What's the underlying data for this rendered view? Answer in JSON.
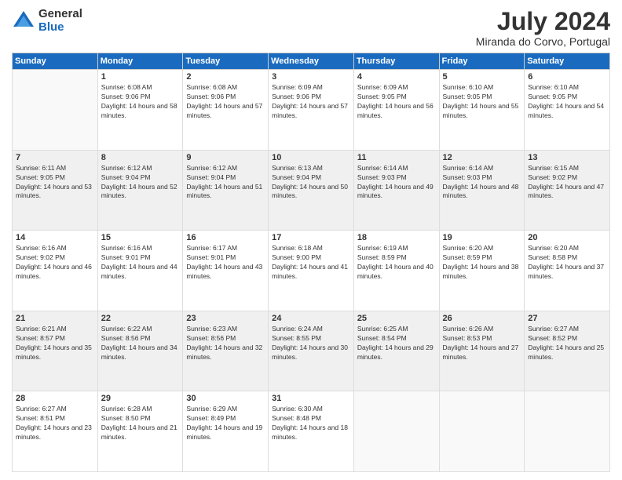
{
  "logo": {
    "general": "General",
    "blue": "Blue"
  },
  "title": "July 2024",
  "location": "Miranda do Corvo, Portugal",
  "weekdays": [
    "Sunday",
    "Monday",
    "Tuesday",
    "Wednesday",
    "Thursday",
    "Friday",
    "Saturday"
  ],
  "weeks": [
    [
      {
        "day": "",
        "sunrise": "",
        "sunset": "",
        "daylight": ""
      },
      {
        "day": "1",
        "sunrise": "Sunrise: 6:08 AM",
        "sunset": "Sunset: 9:06 PM",
        "daylight": "Daylight: 14 hours and 58 minutes."
      },
      {
        "day": "2",
        "sunrise": "Sunrise: 6:08 AM",
        "sunset": "Sunset: 9:06 PM",
        "daylight": "Daylight: 14 hours and 57 minutes."
      },
      {
        "day": "3",
        "sunrise": "Sunrise: 6:09 AM",
        "sunset": "Sunset: 9:06 PM",
        "daylight": "Daylight: 14 hours and 57 minutes."
      },
      {
        "day": "4",
        "sunrise": "Sunrise: 6:09 AM",
        "sunset": "Sunset: 9:05 PM",
        "daylight": "Daylight: 14 hours and 56 minutes."
      },
      {
        "day": "5",
        "sunrise": "Sunrise: 6:10 AM",
        "sunset": "Sunset: 9:05 PM",
        "daylight": "Daylight: 14 hours and 55 minutes."
      },
      {
        "day": "6",
        "sunrise": "Sunrise: 6:10 AM",
        "sunset": "Sunset: 9:05 PM",
        "daylight": "Daylight: 14 hours and 54 minutes."
      }
    ],
    [
      {
        "day": "7",
        "sunrise": "Sunrise: 6:11 AM",
        "sunset": "Sunset: 9:05 PM",
        "daylight": "Daylight: 14 hours and 53 minutes."
      },
      {
        "day": "8",
        "sunrise": "Sunrise: 6:12 AM",
        "sunset": "Sunset: 9:04 PM",
        "daylight": "Daylight: 14 hours and 52 minutes."
      },
      {
        "day": "9",
        "sunrise": "Sunrise: 6:12 AM",
        "sunset": "Sunset: 9:04 PM",
        "daylight": "Daylight: 14 hours and 51 minutes."
      },
      {
        "day": "10",
        "sunrise": "Sunrise: 6:13 AM",
        "sunset": "Sunset: 9:04 PM",
        "daylight": "Daylight: 14 hours and 50 minutes."
      },
      {
        "day": "11",
        "sunrise": "Sunrise: 6:14 AM",
        "sunset": "Sunset: 9:03 PM",
        "daylight": "Daylight: 14 hours and 49 minutes."
      },
      {
        "day": "12",
        "sunrise": "Sunrise: 6:14 AM",
        "sunset": "Sunset: 9:03 PM",
        "daylight": "Daylight: 14 hours and 48 minutes."
      },
      {
        "day": "13",
        "sunrise": "Sunrise: 6:15 AM",
        "sunset": "Sunset: 9:02 PM",
        "daylight": "Daylight: 14 hours and 47 minutes."
      }
    ],
    [
      {
        "day": "14",
        "sunrise": "Sunrise: 6:16 AM",
        "sunset": "Sunset: 9:02 PM",
        "daylight": "Daylight: 14 hours and 46 minutes."
      },
      {
        "day": "15",
        "sunrise": "Sunrise: 6:16 AM",
        "sunset": "Sunset: 9:01 PM",
        "daylight": "Daylight: 14 hours and 44 minutes."
      },
      {
        "day": "16",
        "sunrise": "Sunrise: 6:17 AM",
        "sunset": "Sunset: 9:01 PM",
        "daylight": "Daylight: 14 hours and 43 minutes."
      },
      {
        "day": "17",
        "sunrise": "Sunrise: 6:18 AM",
        "sunset": "Sunset: 9:00 PM",
        "daylight": "Daylight: 14 hours and 41 minutes."
      },
      {
        "day": "18",
        "sunrise": "Sunrise: 6:19 AM",
        "sunset": "Sunset: 8:59 PM",
        "daylight": "Daylight: 14 hours and 40 minutes."
      },
      {
        "day": "19",
        "sunrise": "Sunrise: 6:20 AM",
        "sunset": "Sunset: 8:59 PM",
        "daylight": "Daylight: 14 hours and 38 minutes."
      },
      {
        "day": "20",
        "sunrise": "Sunrise: 6:20 AM",
        "sunset": "Sunset: 8:58 PM",
        "daylight": "Daylight: 14 hours and 37 minutes."
      }
    ],
    [
      {
        "day": "21",
        "sunrise": "Sunrise: 6:21 AM",
        "sunset": "Sunset: 8:57 PM",
        "daylight": "Daylight: 14 hours and 35 minutes."
      },
      {
        "day": "22",
        "sunrise": "Sunrise: 6:22 AM",
        "sunset": "Sunset: 8:56 PM",
        "daylight": "Daylight: 14 hours and 34 minutes."
      },
      {
        "day": "23",
        "sunrise": "Sunrise: 6:23 AM",
        "sunset": "Sunset: 8:56 PM",
        "daylight": "Daylight: 14 hours and 32 minutes."
      },
      {
        "day": "24",
        "sunrise": "Sunrise: 6:24 AM",
        "sunset": "Sunset: 8:55 PM",
        "daylight": "Daylight: 14 hours and 30 minutes."
      },
      {
        "day": "25",
        "sunrise": "Sunrise: 6:25 AM",
        "sunset": "Sunset: 8:54 PM",
        "daylight": "Daylight: 14 hours and 29 minutes."
      },
      {
        "day": "26",
        "sunrise": "Sunrise: 6:26 AM",
        "sunset": "Sunset: 8:53 PM",
        "daylight": "Daylight: 14 hours and 27 minutes."
      },
      {
        "day": "27",
        "sunrise": "Sunrise: 6:27 AM",
        "sunset": "Sunset: 8:52 PM",
        "daylight": "Daylight: 14 hours and 25 minutes."
      }
    ],
    [
      {
        "day": "28",
        "sunrise": "Sunrise: 6:27 AM",
        "sunset": "Sunset: 8:51 PM",
        "daylight": "Daylight: 14 hours and 23 minutes."
      },
      {
        "day": "29",
        "sunrise": "Sunrise: 6:28 AM",
        "sunset": "Sunset: 8:50 PM",
        "daylight": "Daylight: 14 hours and 21 minutes."
      },
      {
        "day": "30",
        "sunrise": "Sunrise: 6:29 AM",
        "sunset": "Sunset: 8:49 PM",
        "daylight": "Daylight: 14 hours and 19 minutes."
      },
      {
        "day": "31",
        "sunrise": "Sunrise: 6:30 AM",
        "sunset": "Sunset: 8:48 PM",
        "daylight": "Daylight: 14 hours and 18 minutes."
      },
      {
        "day": "",
        "sunrise": "",
        "sunset": "",
        "daylight": ""
      },
      {
        "day": "",
        "sunrise": "",
        "sunset": "",
        "daylight": ""
      },
      {
        "day": "",
        "sunrise": "",
        "sunset": "",
        "daylight": ""
      }
    ]
  ]
}
